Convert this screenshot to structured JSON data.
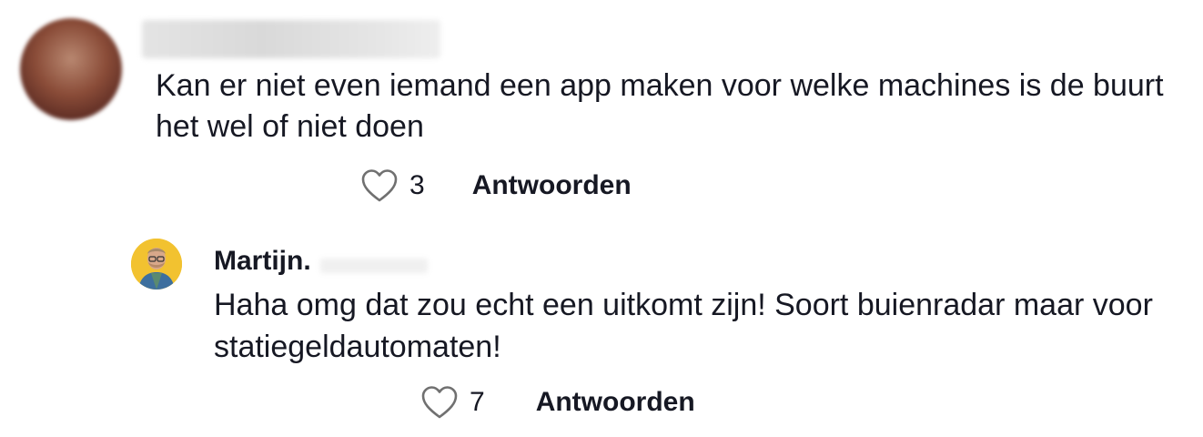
{
  "comments": [
    {
      "text": "Kan er niet even iemand een app maken voor welke machines is de buurt het wel of niet doen",
      "likes": "3",
      "reply_label": "Antwoorden"
    }
  ],
  "reply": {
    "username": "Martijn.",
    "text": "Haha omg dat zou echt een uitkomt zijn! Soort buienradar maar voor statiegeldautomaten!",
    "likes": "7",
    "reply_label": "Antwoorden"
  },
  "icons": {
    "like": "heart-outline-icon"
  },
  "colors": {
    "text": "#161823",
    "avatar_reply_bg": "#f2c230"
  }
}
